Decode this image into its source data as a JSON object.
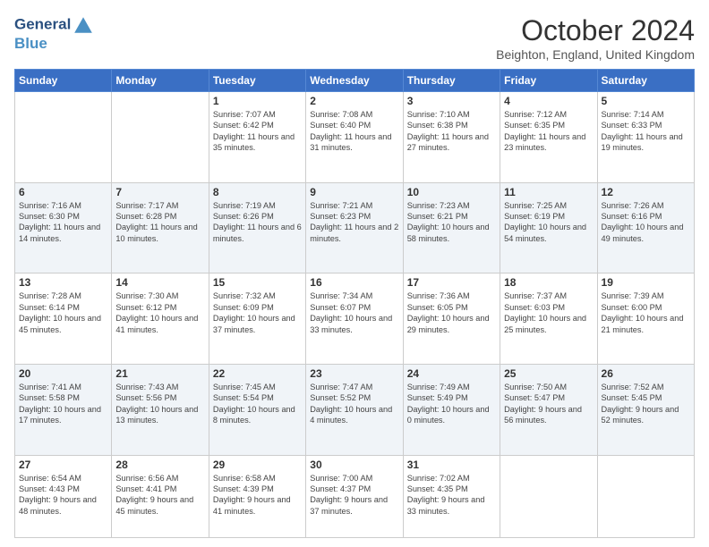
{
  "header": {
    "logo_line1": "General",
    "logo_line2": "Blue",
    "month": "October 2024",
    "location": "Beighton, England, United Kingdom"
  },
  "weekdays": [
    "Sunday",
    "Monday",
    "Tuesday",
    "Wednesday",
    "Thursday",
    "Friday",
    "Saturday"
  ],
  "weeks": [
    [
      {
        "day": "",
        "info": ""
      },
      {
        "day": "",
        "info": ""
      },
      {
        "day": "1",
        "info": "Sunrise: 7:07 AM\nSunset: 6:42 PM\nDaylight: 11 hours and 35 minutes."
      },
      {
        "day": "2",
        "info": "Sunrise: 7:08 AM\nSunset: 6:40 PM\nDaylight: 11 hours and 31 minutes."
      },
      {
        "day": "3",
        "info": "Sunrise: 7:10 AM\nSunset: 6:38 PM\nDaylight: 11 hours and 27 minutes."
      },
      {
        "day": "4",
        "info": "Sunrise: 7:12 AM\nSunset: 6:35 PM\nDaylight: 11 hours and 23 minutes."
      },
      {
        "day": "5",
        "info": "Sunrise: 7:14 AM\nSunset: 6:33 PM\nDaylight: 11 hours and 19 minutes."
      }
    ],
    [
      {
        "day": "6",
        "info": "Sunrise: 7:16 AM\nSunset: 6:30 PM\nDaylight: 11 hours and 14 minutes."
      },
      {
        "day": "7",
        "info": "Sunrise: 7:17 AM\nSunset: 6:28 PM\nDaylight: 11 hours and 10 minutes."
      },
      {
        "day": "8",
        "info": "Sunrise: 7:19 AM\nSunset: 6:26 PM\nDaylight: 11 hours and 6 minutes."
      },
      {
        "day": "9",
        "info": "Sunrise: 7:21 AM\nSunset: 6:23 PM\nDaylight: 11 hours and 2 minutes."
      },
      {
        "day": "10",
        "info": "Sunrise: 7:23 AM\nSunset: 6:21 PM\nDaylight: 10 hours and 58 minutes."
      },
      {
        "day": "11",
        "info": "Sunrise: 7:25 AM\nSunset: 6:19 PM\nDaylight: 10 hours and 54 minutes."
      },
      {
        "day": "12",
        "info": "Sunrise: 7:26 AM\nSunset: 6:16 PM\nDaylight: 10 hours and 49 minutes."
      }
    ],
    [
      {
        "day": "13",
        "info": "Sunrise: 7:28 AM\nSunset: 6:14 PM\nDaylight: 10 hours and 45 minutes."
      },
      {
        "day": "14",
        "info": "Sunrise: 7:30 AM\nSunset: 6:12 PM\nDaylight: 10 hours and 41 minutes."
      },
      {
        "day": "15",
        "info": "Sunrise: 7:32 AM\nSunset: 6:09 PM\nDaylight: 10 hours and 37 minutes."
      },
      {
        "day": "16",
        "info": "Sunrise: 7:34 AM\nSunset: 6:07 PM\nDaylight: 10 hours and 33 minutes."
      },
      {
        "day": "17",
        "info": "Sunrise: 7:36 AM\nSunset: 6:05 PM\nDaylight: 10 hours and 29 minutes."
      },
      {
        "day": "18",
        "info": "Sunrise: 7:37 AM\nSunset: 6:03 PM\nDaylight: 10 hours and 25 minutes."
      },
      {
        "day": "19",
        "info": "Sunrise: 7:39 AM\nSunset: 6:00 PM\nDaylight: 10 hours and 21 minutes."
      }
    ],
    [
      {
        "day": "20",
        "info": "Sunrise: 7:41 AM\nSunset: 5:58 PM\nDaylight: 10 hours and 17 minutes."
      },
      {
        "day": "21",
        "info": "Sunrise: 7:43 AM\nSunset: 5:56 PM\nDaylight: 10 hours and 13 minutes."
      },
      {
        "day": "22",
        "info": "Sunrise: 7:45 AM\nSunset: 5:54 PM\nDaylight: 10 hours and 8 minutes."
      },
      {
        "day": "23",
        "info": "Sunrise: 7:47 AM\nSunset: 5:52 PM\nDaylight: 10 hours and 4 minutes."
      },
      {
        "day": "24",
        "info": "Sunrise: 7:49 AM\nSunset: 5:49 PM\nDaylight: 10 hours and 0 minutes."
      },
      {
        "day": "25",
        "info": "Sunrise: 7:50 AM\nSunset: 5:47 PM\nDaylight: 9 hours and 56 minutes."
      },
      {
        "day": "26",
        "info": "Sunrise: 7:52 AM\nSunset: 5:45 PM\nDaylight: 9 hours and 52 minutes."
      }
    ],
    [
      {
        "day": "27",
        "info": "Sunrise: 6:54 AM\nSunset: 4:43 PM\nDaylight: 9 hours and 48 minutes."
      },
      {
        "day": "28",
        "info": "Sunrise: 6:56 AM\nSunset: 4:41 PM\nDaylight: 9 hours and 45 minutes."
      },
      {
        "day": "29",
        "info": "Sunrise: 6:58 AM\nSunset: 4:39 PM\nDaylight: 9 hours and 41 minutes."
      },
      {
        "day": "30",
        "info": "Sunrise: 7:00 AM\nSunset: 4:37 PM\nDaylight: 9 hours and 37 minutes."
      },
      {
        "day": "31",
        "info": "Sunrise: 7:02 AM\nSunset: 4:35 PM\nDaylight: 9 hours and 33 minutes."
      },
      {
        "day": "",
        "info": ""
      },
      {
        "day": "",
        "info": ""
      }
    ]
  ]
}
